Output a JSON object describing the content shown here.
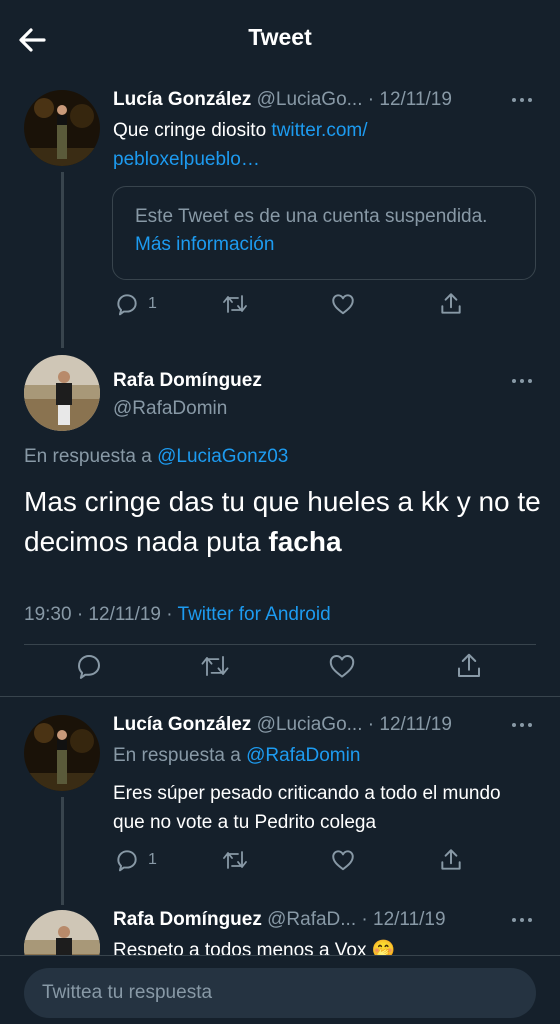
{
  "header": {
    "title": "Tweet",
    "back_icon": "arrow-left-icon"
  },
  "tweets": [
    {
      "author": "Lucía González",
      "handle": "@LuciaGo...",
      "date": "· 12/11/19",
      "text_prefix": "Que cringe diosito ",
      "link1": "twitter.com/",
      "link2": "pebloxelpueblo…",
      "card_text": "Este Tweet es de una cuenta suspendida.",
      "card_link": "Más información",
      "replies": "1"
    },
    {
      "author": "Rafa Domínguez",
      "handle": "@RafaDomin",
      "reply_prefix": "En respuesta a ",
      "reply_to": "@LuciaGonz03",
      "text_plain": "Mas cringe das tu que hueles a kk y no te decimos nada puta ",
      "text_bold": "facha",
      "time": "19:30",
      "date": "· 12/11/19 ·",
      "source": "Twitter for Android"
    },
    {
      "author": "Lucía González",
      "handle": "@LuciaGo...",
      "date": "· 12/11/19",
      "reply_prefix": "En respuesta a ",
      "reply_to": "@RafaDomin",
      "text": "Eres súper pesado criticando a todo el mundo que no vote a tu Pedrito colega",
      "replies": "1"
    },
    {
      "author": "Rafa Domínguez",
      "handle": "@RafaD...",
      "date": "· 12/11/19",
      "text": "Respeto a todos menos a Vox",
      "emoji": "🤭"
    }
  ],
  "composer": {
    "placeholder": "Twittea tu respuesta"
  },
  "colors": {
    "background": "#15202b",
    "link": "#1d9bf0",
    "muted": "#8899a6",
    "border": "#38444d"
  }
}
